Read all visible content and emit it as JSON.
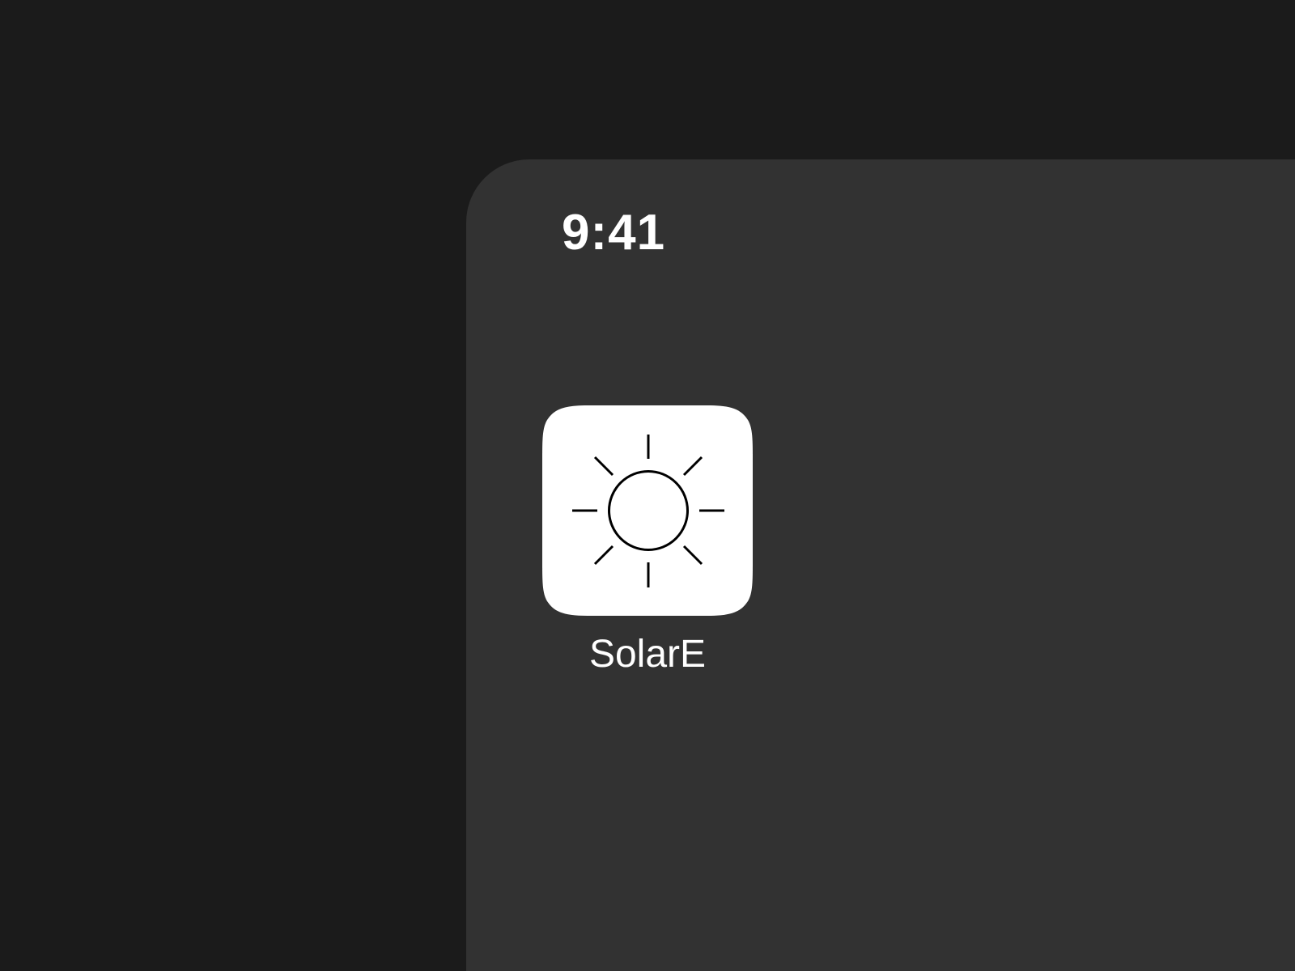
{
  "status_bar": {
    "time": "9:41"
  },
  "home_screen": {
    "apps": [
      {
        "label": "SolarE",
        "icon": "sun-icon"
      }
    ]
  },
  "colors": {
    "backdrop": "#1b1b1b",
    "screen": "#323232",
    "icon_background": "#ffffff",
    "icon_glyph": "#000000",
    "text": "#ffffff"
  }
}
